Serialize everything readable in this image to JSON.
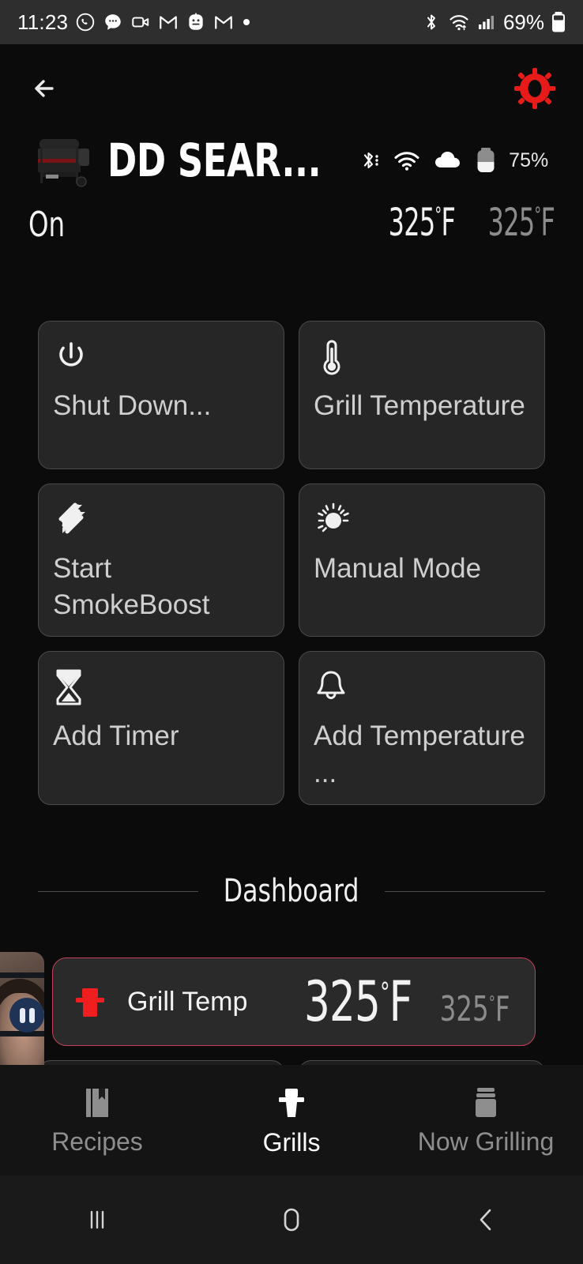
{
  "status_bar": {
    "time": "11:23",
    "battery_percent": "69%",
    "notification_icons": [
      "whatsapp-icon",
      "messages-icon",
      "video-camera-icon",
      "gmail-icon",
      "snapchat-icon",
      "gmail-icon",
      "dot-icon"
    ],
    "system_icons": [
      "bluetooth-icon",
      "wifi-icon",
      "cellular-signal-icon",
      "battery-icon"
    ]
  },
  "topbar": {
    "back_label": "Back",
    "settings_label": "Settings",
    "accent_color": "#e81b1b"
  },
  "grill_header": {
    "title": "DD SEAR...",
    "status": "On",
    "current_temp": "325",
    "current_unit": "F",
    "target_temp": "325",
    "target_unit": "F",
    "degree": "°",
    "battery_percent": "75%",
    "connectivity_icons": [
      "bluetooth-icon",
      "wifi-icon",
      "cloud-icon",
      "battery-icon"
    ]
  },
  "actions": [
    {
      "icon": "power-icon",
      "label": "Shut Down..."
    },
    {
      "icon": "thermometer-icon",
      "label": "Grill Temperature"
    },
    {
      "icon": "smoke-icon",
      "label": "Start SmokeBoost"
    },
    {
      "icon": "sun-icon",
      "label": "Manual Mode"
    },
    {
      "icon": "hourglass-icon",
      "label": "Add Timer"
    },
    {
      "icon": "bell-icon",
      "label": "Add Temperature ..."
    }
  ],
  "dashboard": {
    "title": "Dashboard",
    "rows": [
      {
        "icon": "grill-icon",
        "icon_color": "#f01e1e",
        "label": "Grill Temp",
        "value": "325",
        "unit": "F",
        "target": "325",
        "target_unit": "F",
        "degree": "°",
        "border_color": "#c4415a"
      }
    ]
  },
  "bottom_nav": [
    {
      "icon": "book-icon",
      "label": "Recipes",
      "active": false
    },
    {
      "icon": "grill-icon",
      "label": "Grills",
      "active": true
    },
    {
      "icon": "stack-icon",
      "label": "Now Grilling",
      "active": false
    }
  ],
  "system_nav": [
    {
      "icon": "recents-icon",
      "label": "Recents"
    },
    {
      "icon": "home-icon",
      "label": "Home"
    },
    {
      "icon": "back-icon",
      "label": "Back"
    }
  ],
  "pip": {
    "label": "Video call overlay",
    "button_icon": "pause-icon"
  }
}
